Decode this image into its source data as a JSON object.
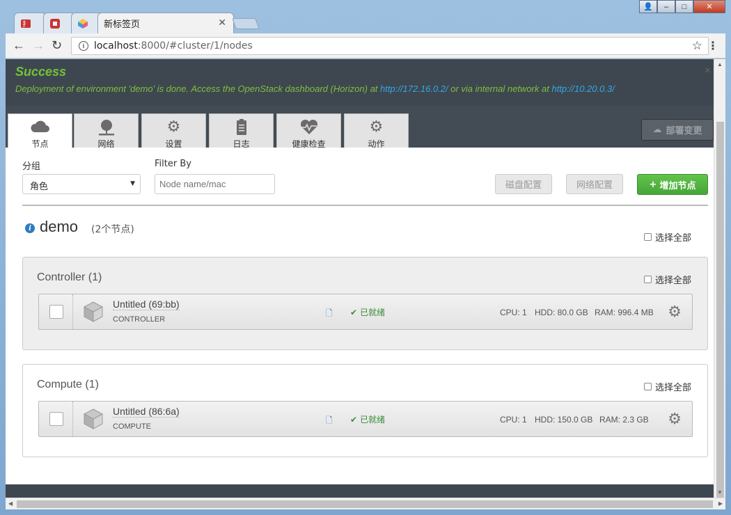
{
  "browser": {
    "tabs": [
      {
        "label": ""
      },
      {
        "label": ""
      },
      {
        "label": ""
      },
      {
        "label": "新标签页"
      }
    ],
    "url_host": "localhost",
    "url_path": ":8000/#cluster/1/nodes",
    "window_buttons": {
      "user": "👤",
      "minimize": "–",
      "maximize": "□",
      "close": "✕"
    }
  },
  "alert": {
    "title": "Success",
    "message_prefix": "Deployment of environment 'demo' is done. Access the OpenStack dashboard (Horizon) at ",
    "link1": "http://172.16.0.2/",
    "message_mid": " or via internal network at ",
    "link2": "http://10.20.0.3/"
  },
  "nav_tabs": [
    {
      "label": "节点",
      "icon": "cloud-icon"
    },
    {
      "label": "网络",
      "icon": "network-icon"
    },
    {
      "label": "设置",
      "icon": "gear-icon"
    },
    {
      "label": "日志",
      "icon": "clipboard-icon"
    },
    {
      "label": "健康检查",
      "icon": "heartbeat-icon"
    },
    {
      "label": "动作",
      "icon": "gears-icon"
    }
  ],
  "deploy_button": "部署变更",
  "filters": {
    "group_label": "分组",
    "group_value": "角色",
    "filter_label": "Filter By",
    "filter_placeholder": "Node name/mac",
    "disk_btn": "磁盘配置",
    "net_btn": "网络配置",
    "add_btn": "增加节点"
  },
  "cluster": {
    "name": "demo",
    "count": "(2个节点)",
    "select_all": "选择全部"
  },
  "groups": [
    {
      "title": "Controller (1)",
      "select_all": "选择全部",
      "nodes": [
        {
          "name": "Untitled (69:bb)",
          "role": "CONTROLLER",
          "status": "已就绪",
          "cpu": "CPU: 1",
          "hdd": "HDD: 80.0 GB",
          "ram": "RAM: 996.4 MB"
        }
      ]
    },
    {
      "title": "Compute (1)",
      "select_all": "选择全部",
      "nodes": [
        {
          "name": "Untitled (86:6a)",
          "role": "COMPUTE",
          "status": "已就绪",
          "cpu": "CPU: 1",
          "hdd": "HDD: 150.0 GB",
          "ram": "RAM: 2.3 GB"
        }
      ]
    }
  ],
  "colors": {
    "success": "#73c23a",
    "link": "#33a8e8",
    "add": "#4cae3c"
  }
}
